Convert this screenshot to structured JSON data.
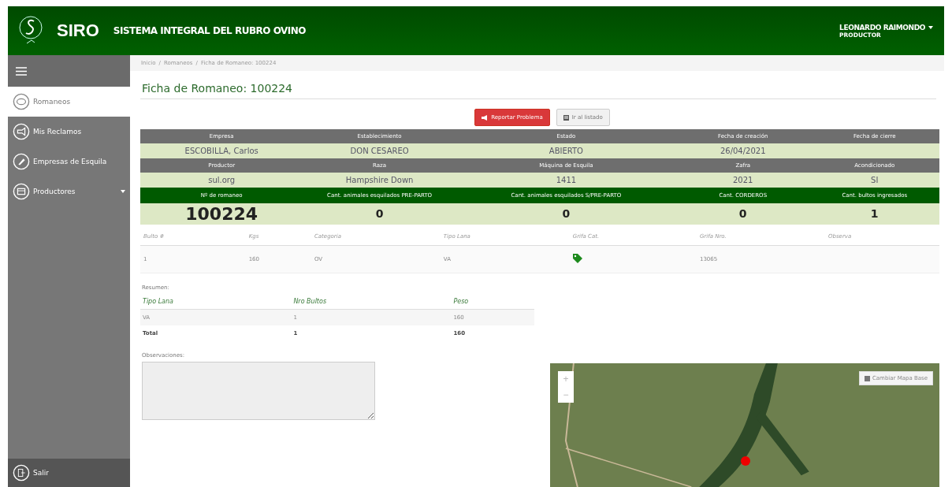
{
  "header": {
    "logo": "SIRO",
    "subtitle": "SISTEMA INTEGRAL DEL RUBRO OVINO",
    "user_name": "LEONARDO RAIMONDO",
    "user_role": "PRODUCTOR"
  },
  "sidebar": {
    "items": [
      {
        "label": "Romaneos",
        "selected": true,
        "has_submenu": false
      },
      {
        "label": "Mis Reclamos",
        "selected": false,
        "has_submenu": false
      },
      {
        "label": "Empresas de Esquila",
        "selected": false,
        "has_submenu": false
      },
      {
        "label": "Productores",
        "selected": false,
        "has_submenu": true
      }
    ],
    "logout": "Salir"
  },
  "breadcrumb": {
    "separator": "/",
    "items": [
      "Inicio",
      "Romaneos",
      "Ficha de Romaneo: 100224"
    ]
  },
  "title": "Ficha de Romaneo: 100224",
  "buttons": [
    {
      "label": "Reportar Problema",
      "kind": "danger"
    },
    {
      "label": "Ir al listado",
      "kind": "default"
    }
  ],
  "info_bands": [
    {
      "kind": "gray",
      "headers": [
        "Empresa",
        "Establecimiento",
        "Estado",
        "Fecha de creación",
        "Fecha de cierre"
      ],
      "values": [
        "ESCOBILLA, Carlos",
        "DON CESAREO",
        "ABIERTO",
        "26/04/2021"
      ]
    },
    {
      "kind": "gray",
      "headers": [
        "Productor",
        "Raza",
        "Máquina de Esquila",
        "Zafra",
        "Acondicionado"
      ],
      "values": [
        "sul.org",
        "Hampshire Down",
        "1411",
        "2021",
        "SI"
      ]
    },
    {
      "kind": "green",
      "headers": [
        "Nº de romaneo",
        "Cant. animales esquilados PRE-PARTO",
        "Cant. animales esquilados S/PRE-PARTO",
        "Cant. CORDEROS",
        "Cant. bultos ingresados"
      ],
      "values": [
        "100224",
        "0",
        "0",
        "0",
        "1"
      ]
    }
  ],
  "bultos": {
    "columns": [
      "Bulto #",
      "Kgs",
      "Categoria",
      "Tipo Lana",
      "Grifa Cat.",
      "Grifa Nro.",
      "Observa"
    ],
    "rows": [
      {
        "bulto": "1",
        "kgs": "160",
        "categoria": "OV",
        "tipo_lana": "VA",
        "grifa_tag": true,
        "grifa_nro": "13065"
      }
    ]
  },
  "resumen": {
    "label": "Resumen:",
    "columns": [
      "Tipo Lana",
      "Nro Bultos",
      "Peso"
    ],
    "rows": [
      [
        "VA",
        "1",
        "160"
      ]
    ],
    "total": [
      "Total",
      "1",
      "160"
    ]
  },
  "observaciones": {
    "label": "Observaciones:"
  },
  "map": {
    "zoom_in": "+",
    "zoom_out": "−",
    "button": "Cambiar Mapa Base"
  }
}
